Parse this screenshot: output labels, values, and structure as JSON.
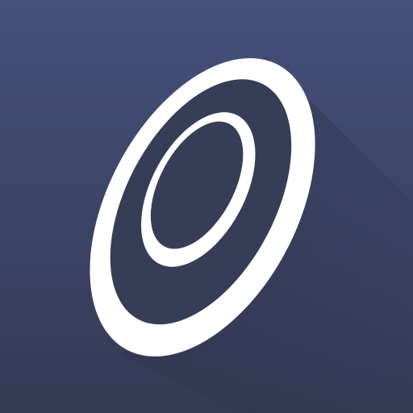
{
  "icon": {
    "name": "concentric-rings-logo",
    "colors": {
      "background_top": "#46507a",
      "background_bottom": "#343a54",
      "ring": "#ffffff",
      "inner": "#363d57",
      "shadow": "#2b3047"
    }
  }
}
